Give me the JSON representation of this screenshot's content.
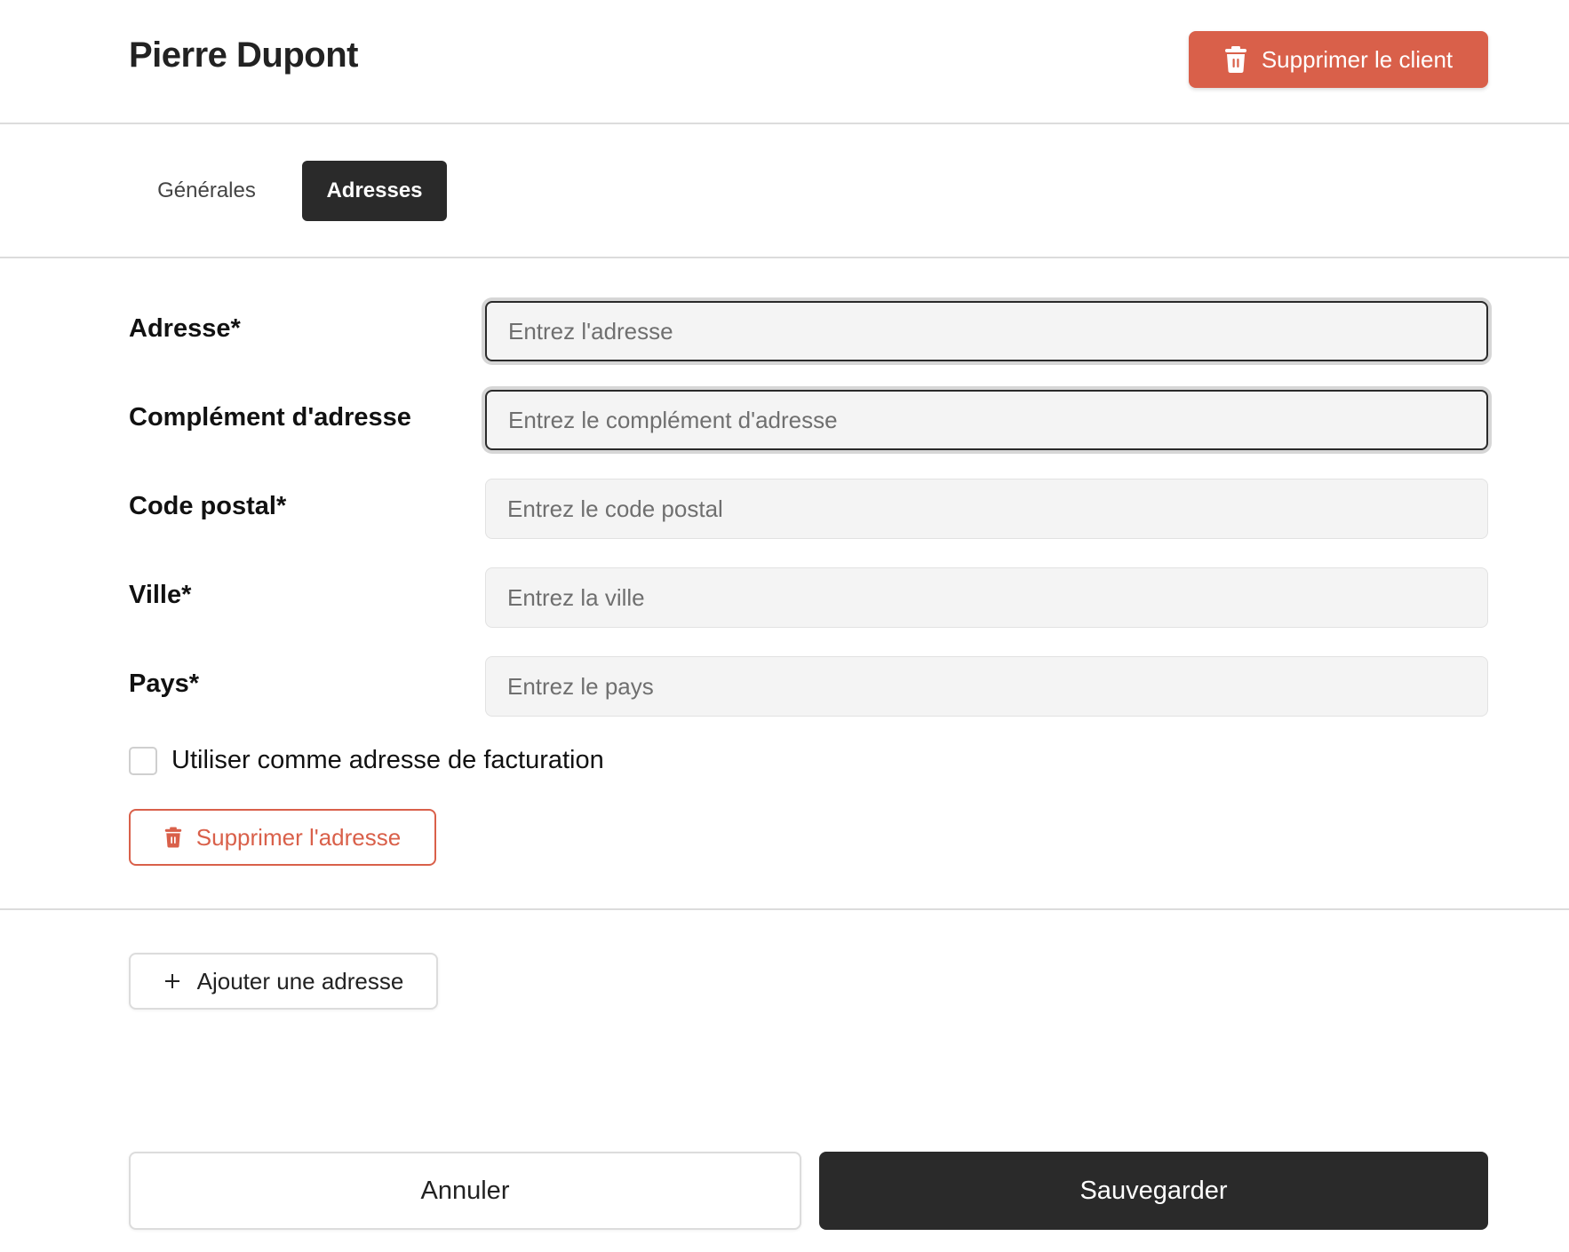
{
  "header": {
    "title": "Pierre Dupont",
    "delete_client_label": "Supprimer le client",
    "delete_icon": "trash-icon"
  },
  "tabs": [
    {
      "label": "Générales",
      "active": false
    },
    {
      "label": "Adresses",
      "active": true
    }
  ],
  "form": {
    "adresse": {
      "label": "Adresse*",
      "placeholder": "Entrez l'adresse",
      "value": ""
    },
    "complement": {
      "label": "Complément d'adresse",
      "placeholder": "Entrez le complément d'adresse",
      "value": ""
    },
    "code_postal": {
      "label": "Code postal*",
      "placeholder": "Entrez le code postal",
      "value": ""
    },
    "ville": {
      "label": "Ville*",
      "placeholder": "Entrez la ville",
      "value": ""
    },
    "pays": {
      "label": "Pays*",
      "placeholder": "Entrez le pays",
      "value": ""
    },
    "billing_checkbox": {
      "label": "Utiliser comme adresse de facturation",
      "checked": false
    },
    "delete_address_label": "Supprimer l'adresse"
  },
  "add_address_label": "Ajouter une adresse",
  "footer": {
    "cancel_label": "Annuler",
    "save_label": "Sauvegarder"
  },
  "colors": {
    "danger": "#d9604a",
    "dark": "#2a2a2a",
    "input_bg": "#f4f4f4"
  }
}
